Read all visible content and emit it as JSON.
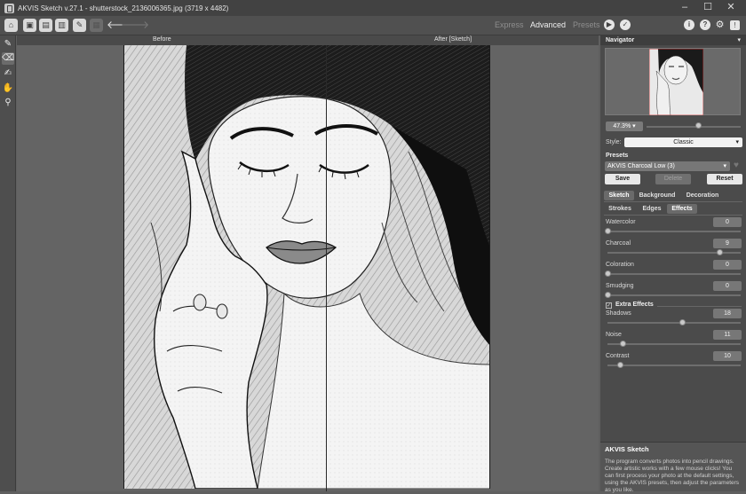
{
  "window": {
    "title": "AKVIS Sketch v.27.1 - shutterstock_2136006365.jpg (3719 x 4482)",
    "minimize": "–",
    "maximize": "☐",
    "close": "✕"
  },
  "toolbar": {
    "modes": [
      "Express",
      "Advanced",
      "Presets"
    ],
    "active_mode": "Advanced",
    "run_glyph": "▶",
    "apply_glyph": "✓",
    "back_glyph": "🡐",
    "forward_glyph": "🡒",
    "info_glyph": "i",
    "help_glyph": "?",
    "settings_glyph": "⚙",
    "notify_glyph": "!"
  },
  "tools": [
    "pencil-icon",
    "eraser-icon",
    "stroke-icon",
    "hand-icon",
    "zoom-icon"
  ],
  "viewer": {
    "before_label": "Before",
    "after_label": "After [Sketch]"
  },
  "panel": {
    "navigator_title": "Navigator",
    "zoom": "47.3%",
    "zoom_fraction": 0.55,
    "style_label": "Style:",
    "style_value": "Classic",
    "presets_label": "Presets",
    "preset_value": "AKVIS Charcoal Low (3)",
    "save_label": "Save",
    "delete_label": "Delete",
    "reset_label": "Reset",
    "tabs": [
      "Sketch",
      "Background",
      "Decoration"
    ],
    "subtabs": [
      "Strokes",
      "Edges",
      "Effects"
    ],
    "params": [
      {
        "label": "Watercolor",
        "value": "0",
        "fraction": 0.0
      },
      {
        "label": "Charcoal",
        "value": "9",
        "fraction": 0.9
      },
      {
        "label": "Coloration",
        "value": "0",
        "fraction": 0.0
      },
      {
        "label": "Smudging",
        "value": "0",
        "fraction": 0.0
      }
    ],
    "extra_effects_label": "Extra Effects",
    "extra_effects_checked": true,
    "extra_params": [
      {
        "label": "Shadows",
        "value": "18",
        "fraction": 0.6
      },
      {
        "label": "Noise",
        "value": "11",
        "fraction": 0.12
      },
      {
        "label": "Contrast",
        "value": "10",
        "fraction": 0.1
      }
    ],
    "info_title": "AKVIS Sketch",
    "info_text": "The program converts photos into pencil drawings. Create artistic works with a few mouse clicks! You can first process your photo at the default settings, using the AKVIS presets, then adjust the parameters as you like."
  }
}
